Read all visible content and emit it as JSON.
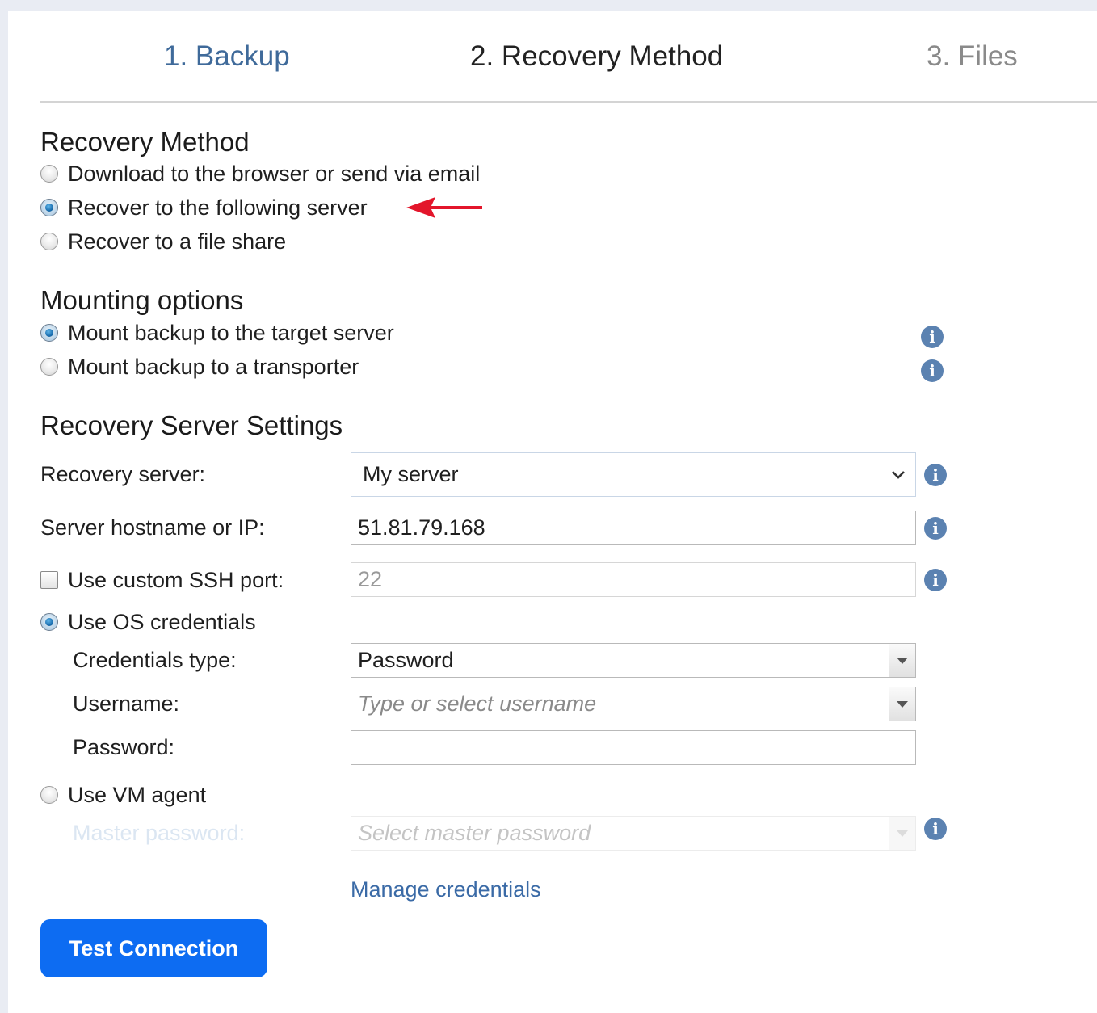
{
  "wizard": {
    "steps": [
      {
        "label": "1. Backup",
        "state": "completed"
      },
      {
        "label": "2. Recovery Method",
        "state": "active"
      },
      {
        "label": "3. Files",
        "state": "pending"
      }
    ]
  },
  "recovery_method": {
    "title": "Recovery Method",
    "options": [
      {
        "label": "Download to the browser or send via email",
        "checked": false
      },
      {
        "label": "Recover to the following server",
        "checked": true
      },
      {
        "label": "Recover to a file share",
        "checked": false
      }
    ]
  },
  "mounting": {
    "title": "Mounting options",
    "options": [
      {
        "label": "Mount backup to the target server",
        "checked": true
      },
      {
        "label": "Mount backup to a transporter",
        "checked": false
      }
    ]
  },
  "server_settings": {
    "title": "Recovery Server Settings",
    "recovery_server_label": "Recovery server:",
    "recovery_server_value": "My server",
    "hostname_label": "Server hostname or IP:",
    "hostname_value": "51.81.79.168",
    "ssh_port_label": "Use custom SSH port:",
    "ssh_port_checked": false,
    "ssh_port_value": "22",
    "os_credentials_label": "Use OS credentials",
    "os_credentials_checked": true,
    "credentials_type_label": "Credentials type:",
    "credentials_type_value": "Password",
    "username_label": "Username:",
    "username_placeholder": "Type or select username",
    "password_label": "Password:",
    "password_value": "",
    "vm_agent_label": "Use VM agent",
    "vm_agent_checked": false,
    "master_password_label": "Master password:",
    "master_password_placeholder": "Select master password",
    "manage_credentials_link": "Manage credentials"
  },
  "actions": {
    "test_connection": "Test Connection"
  },
  "icons": {
    "info": "info-icon",
    "annotation": "red-arrow-icon",
    "dropdown": "chevron-down-icon"
  },
  "colors": {
    "step_completed": "#3f6a9a",
    "step_active": "#222222",
    "step_pending": "#8a8a8a",
    "button_primary": "#0d6cf2",
    "link": "#3a6aa6",
    "info_icon": "#5b82b1",
    "annotation_arrow": "#e3162b"
  }
}
